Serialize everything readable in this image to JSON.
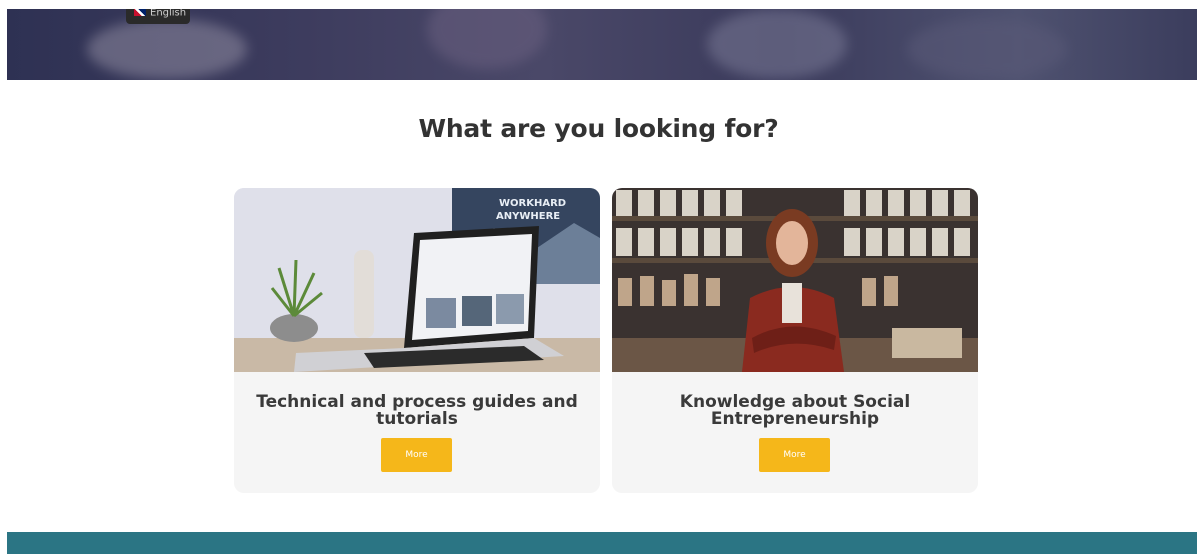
{
  "language": {
    "label": "English",
    "icon": "uk-flag-icon"
  },
  "heading": "What are you looking for?",
  "cards": [
    {
      "title": "Technical and process guides and tutorials",
      "button_label": "More",
      "image": "laptop-workspace-image"
    },
    {
      "title": "Knowledge about Social Entrepreneurship",
      "button_label": "More",
      "image": "woman-in-shop-image"
    }
  ],
  "colors": {
    "accent": "#f5b71a",
    "footer": "#2b7584",
    "hero_overlay": "#3b3b5c"
  }
}
